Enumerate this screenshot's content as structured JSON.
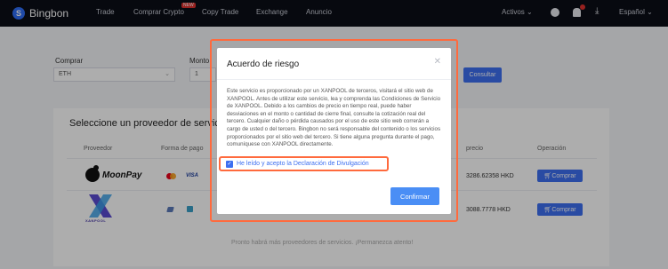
{
  "nav": {
    "brand": "Bingbon",
    "items": [
      "Trade",
      "Comprar Crypto",
      "Copy Trade",
      "Exchange",
      "Anuncio"
    ],
    "badge": "NEW",
    "assets": "Activos",
    "language": "Español"
  },
  "form": {
    "buy_label": "Comprar",
    "amount_label": "Monto",
    "crypto_value": "ETH",
    "amount_value": "1",
    "query_button": "Consultar"
  },
  "providers": {
    "title": "Seleccione un proveedor de servicio",
    "columns": [
      "Proveedor",
      "Forma de pago",
      "precio",
      "Operación"
    ],
    "rows": [
      {
        "name": "MoonPay",
        "price": "3286.62358 HKD",
        "action": "Comprar"
      },
      {
        "name": "XANPOOL",
        "price": "3088.7778 HKD",
        "action": "Comprar"
      }
    ],
    "footer_note": "Pronto habrá más proveedores de servicios. ¡Permanezca atento!"
  },
  "modal": {
    "title": "Acuerdo de riesgo",
    "body": "Este servicio es proporcionado por un XANPOOL de terceros, visitará el sitio web de XANPOOL. Antes de utilizar este servicio, lea y comprenda las Condiciones de Servicio de XANPOOL. Debido a los cambios de precio en tiempo real, puede haber desviaciones en el monto o cantidad de cierre final, consulte la cotización real del tercero. Cualquier daño o pérdida causados por el uso de este sitio web correrán a cargo de usted o del tercero. Bingbon no será responsable del contenido o los servicios proporcionados por el sitio web del tercero. Si tiene alguna pregunta durante el pago, comuníquese con XANPOOL directamente.",
    "checkbox_label": "He leído y acepto la Declaración de Divulgación",
    "confirm_button": "Confirmar"
  },
  "colors": {
    "accent": "#3d6ff0",
    "highlight": "#ff6a3d",
    "topbar": "#0b0e17"
  }
}
